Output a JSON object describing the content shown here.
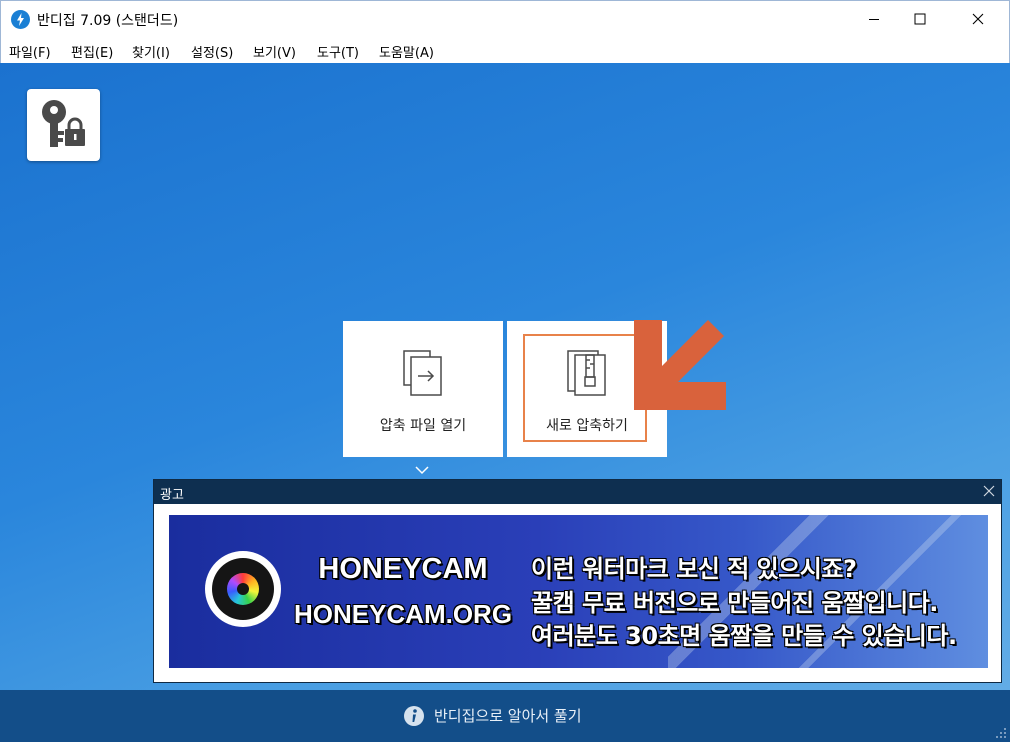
{
  "window": {
    "title": "반디집 7.09 (스탠더드)",
    "controls": [
      "minimize-icon",
      "maximize-icon",
      "close-icon"
    ]
  },
  "menu": {
    "file": "파일(F)",
    "edit": "편집(E)",
    "find": "찾기(I)",
    "settings": "설정(S)",
    "view": "보기(V)",
    "tools": "도구(T)",
    "help": "도움말(A)"
  },
  "main": {
    "key_tile_icon": "key-lock-icon",
    "cards": {
      "open_label": "압축 파일 열기",
      "new_label": "새로 압축하기"
    },
    "highlight_color": "#e8824a",
    "arrow_color": "#d9623c"
  },
  "ad": {
    "header": "광고",
    "brand": "HONEYCAM",
    "url": "HONEYCAM.ORG",
    "line1": "이런 워터마크 보신 적 있으시죠?",
    "line2": "꿀캠 무료 버전으로 만들어진 움짤입니다.",
    "line3": "여러분도 30초면 움짤을 만들 수 있습니다."
  },
  "footer": {
    "text": "반디집으로 알아서 풀기",
    "icon": "info-icon"
  }
}
